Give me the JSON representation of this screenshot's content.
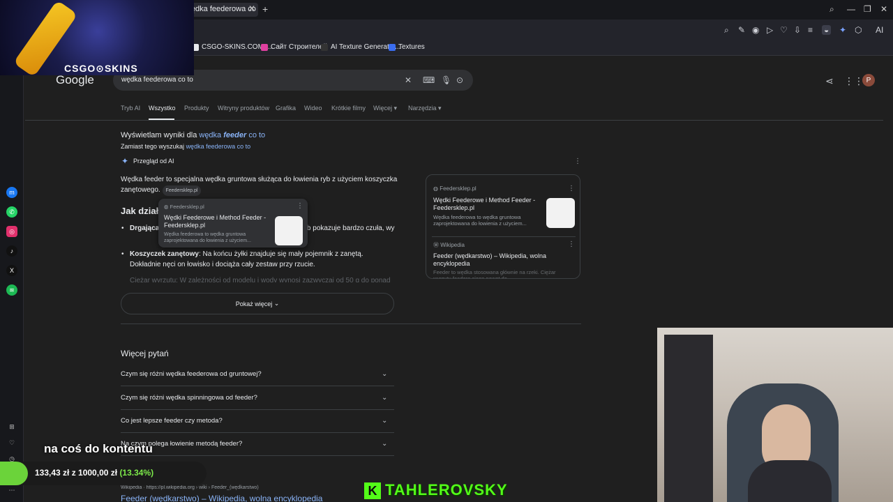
{
  "browser": {
    "tab_title": "wędka feederowa co to -",
    "toolbar_icons": [
      "search-icon",
      "edit-icon",
      "camera-icon",
      "play-icon",
      "heart-icon",
      "download-icon",
      "menu-icon",
      "profile-icon"
    ],
    "ai_button": "AI",
    "bookmarks": [
      {
        "label": "CSGO-SKINS.COM -...",
        "color": "#e8eaed"
      },
      {
        "label": "Сайт Строителей",
        "color": "#e040a0"
      },
      {
        "label": "AI Texture Generator...",
        "color": "#333333"
      },
      {
        "label": "Textures",
        "color": "#3a6df0"
      }
    ]
  },
  "overlay": {
    "csgo_label": "CSGO⊙SKINS",
    "streamer_text": "na coś do kontentu",
    "donation_text": "133,43 zł  z 1000,00 zł",
    "donation_pct": "(13.34%)",
    "donation_progress": 0.1334,
    "kick_logo": "K",
    "kick_name": "TAHLEROVSKY"
  },
  "google": {
    "logo": "Google",
    "query": "wędka feederowa co to",
    "avatar_letter": "P",
    "tabs": [
      "Tryb AI",
      "Wszystko",
      "Produkty",
      "Witryny produktów",
      "Grafika",
      "Wideo",
      "Krótkie filmy",
      "Więcej ▾",
      "Narzędzia ▾"
    ],
    "showing_prefix": "Wyświetlam wyniki dla",
    "showing_link_a": "wędka",
    "showing_link_b": "feeder",
    "showing_link_c": "co to",
    "instead_prefix": "Zamiast tego wyszukaj",
    "instead_link": "wędka feederowa co to",
    "ai_overview_label": "Przegląd od AI",
    "answer": "Wędka feeder to specjalna wędka gruntowa służąca do łowienia ryb z użyciem koszyczka zanętowego.",
    "answer_cite": "Feedersklep.pl",
    "how_heading": "Jak działa",
    "bullet1_bold": "Drgająca",
    "bullet1_tail": "ia ryb pokazuje bardzo czuła, wy",
    "bullet2_bold": "Koszyczek zanętowy",
    "bullet2_text": ": Na końcu żyłki znajduje się mały pojemnik z zanętą. Dokładnie nęci on łowisko i dociąża cały zestaw przy rzucie.",
    "bullet3_faded": "Ciężar wyrzutu: W zależności od modelu i wody wynosi zazwyczaj od 50 g do ponad",
    "popup": {
      "site": "Feedersklep.pl",
      "title": "Wędki Feederowe i Method Feeder - Feedersklep.pl",
      "snippet": "Wędka feederowa to wędka gruntowa zaprojektowana do łowienia z użyciem..."
    },
    "sources": [
      {
        "site": "Feedersklep.pl",
        "title": "Wędki Feederowe i Method Feeder - Feedersklep.pl",
        "snippet": "Wędka feederowa to wędka gruntowa zaprojektowana do łowienia z użyciem..."
      },
      {
        "site": "Wikipedia",
        "title": "Feeder (wędkarstwo) – Wikipedia, wolna encyklopedia",
        "snippet": "Feeder to wędka stosowana głównie na rzeki. Ciężar wyrzutu feedera sięga nawet do ..."
      }
    ],
    "show_more": "Pokaż więcej",
    "paa_heading": "Więcej pytań",
    "paa": [
      "Czym się różni wędka feederowa od gruntowej?",
      "Czym się różni wędka spinningowa od feeder?",
      "Co jest lepsze feeder czy metoda?",
      "Na czym polega łowienie metodą feeder?"
    ],
    "result_site": "Wikipedia",
    "result_url": "https://pl.wikipedia.org › wiki › Feeder_(wędkarstwo)",
    "result_title": "Feeder (wędkarstwo) – Wikipedia, wolna encyklopedia"
  }
}
